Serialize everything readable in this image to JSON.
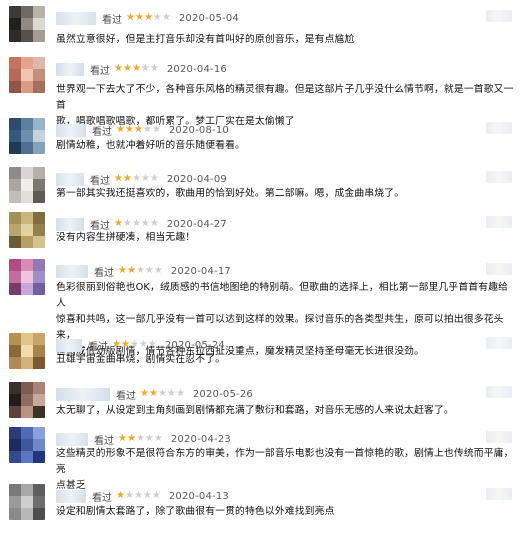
{
  "comments": [
    {
      "watched": "看过",
      "rating": 3,
      "date": "2020-05-04",
      "text": "虽然立意很好，但是主打音乐却没有首叫好的原创音乐，是有点尴尬",
      "avatar": [
        "#3a3a38",
        "#6f6a63",
        "#b9b3ab",
        "#20201f",
        "#8f8a82",
        "#dcd8d2",
        "#2f2b28",
        "#56504a",
        "#a59d93"
      ],
      "name_color": "#d6e2ec",
      "tag": true
    },
    {
      "watched": "看过",
      "rating": 3,
      "date": "2020-04-16",
      "text": "世界观一下去大了不少，各种音乐风格的精灵很有趣。但是这部片子几乎没什么情节啊，就是一首歌又一首\n歌，唱歌唱歌唱歌，都听累了。梦工厂实在是太偷懒了",
      "avatar": [
        "#c2745c",
        "#e2a48a",
        "#d9b9a8",
        "#b86a5a",
        "#f0c6b2",
        "#c48e7d",
        "#8e5646",
        "#d79c83",
        "#a86e5c"
      ],
      "name_color": "#d2dee9",
      "tag": false
    },
    {
      "watched": "看过",
      "rating": 3,
      "date": "2020-08-10",
      "text": "剧情幼稚，也就冲着好听的音乐随便看看。",
      "avatar": [
        "#2c4c6b",
        "#5c7f9e",
        "#9ab4c8",
        "#335a7c",
        "#6b8fad",
        "#c3d2dc",
        "#1f3a56",
        "#4d7091",
        "#86a2b9"
      ],
      "name_color": "#d4e0eb",
      "tag": true
    },
    {
      "watched": "看过",
      "rating": 2,
      "date": "2020-04-09",
      "text": "第一部其实我还挺喜欢的，歌曲用的恰到好处。第二部嘛。嗯，成金曲串烧了。",
      "avatar": [
        "#8e8c88",
        "#d8d6d2",
        "#b3afaa",
        "#a9a6a2",
        "#f0eeeb",
        "#7b7772",
        "#c2bfba",
        "#e2dfdb",
        "#5e5b57"
      ],
      "name_color": "#d7e1ea",
      "tag": true
    },
    {
      "watched": "看过",
      "rating": 1,
      "date": "2020-04-27",
      "text": "没有内容生拼硬凑，相当无趣！",
      "avatar": [
        "#a39054",
        "#c9b67c",
        "#7f6e3e",
        "#b9a668",
        "#e0d2a0",
        "#93804a",
        "#6b5c33",
        "#b3a062",
        "#d3c38c"
      ],
      "name_color": "#d3dfe9",
      "tag": true
    },
    {
      "watched": "看过",
      "rating": 2,
      "date": "2020-04-17",
      "text": "色彩很丽到俗艳也OK，绒质感的书信地图绝的特别萌。但歌曲的选择上，相比第一部里几乎首首有趣给人\n惊喜和共鸣，这一部几乎没有一首可以达到这样的效果。探讨音乐的各类型共生，原可以拍出很多花头来，\n但搞成低幼版剧情，情节各种东拉西扯没重点，魔发精灵坚持圣母毫无长进很没劲。",
      "avatar": [
        "#b24a86",
        "#d98bb8",
        "#8e7ab8",
        "#c56c9e",
        "#efc3dc",
        "#9e90c6",
        "#7c3a6a",
        "#c7a6d8",
        "#6f5fa0"
      ],
      "name_color": "#d5e0ea",
      "tag": true
    },
    {
      "watched": "看过",
      "rating": 2,
      "date": "2020-05-24",
      "text": "丑雄宇宙金曲串烧，剧情实在忍不了。",
      "avatar": [
        "#b89050",
        "#e0c488",
        "#c9a46a",
        "#8c6a38",
        "#f0dcac",
        "#a8844a",
        "#b08a52",
        "#d2b27a",
        "#7c5a2e"
      ],
      "name_color": "#d6e1eb",
      "tag": true
    },
    {
      "watched": "看过",
      "rating": 2,
      "date": "2020-05-26",
      "text": "太无聊了，从设定到主角刻画到剧情都充满了敷衍和套路，对音乐无感的人来说太赶客了。",
      "avatar": [
        "#3b2f2c",
        "#7a5c50",
        "#a98474",
        "#241c1a",
        "#8f6d60",
        "#c8a898",
        "#5a443c",
        "#b89282",
        "#3e302b"
      ],
      "name_color": "#d3deea",
      "tag": true
    },
    {
      "watched": "看过",
      "rating": 2,
      "date": "2020-04-23",
      "text": "这些精灵的形象不是很符合东方的审美，作为一部音乐电影也没有一首惊艳的歌，剧情上也传统而平庸，亮\n点甚乏",
      "avatar": [
        "#2a3d7a",
        "#4f6bb8",
        "#8aa0d8",
        "#1c2c60",
        "#3e58a0",
        "#6f88c8",
        "#324a8e",
        "#5a76c0",
        "#22367c"
      ],
      "name_color": "#d7e1ec",
      "tag": true
    },
    {
      "watched": "看过",
      "rating": 1,
      "date": "2020-04-13",
      "text": "设定和剧情太套路了，除了歌曲很有一贯的特色以外难找到亮点",
      "avatar": [
        "#7a7a7a",
        "#a8a8a8",
        "#5e5e5e",
        "#9a9a9a",
        "#cfcfcf",
        "#6e6e6e",
        "#8a8a8a",
        "#b8b8b8",
        "#4e4e4e"
      ],
      "name_color": "#d5dfe9",
      "tag": true
    }
  ]
}
